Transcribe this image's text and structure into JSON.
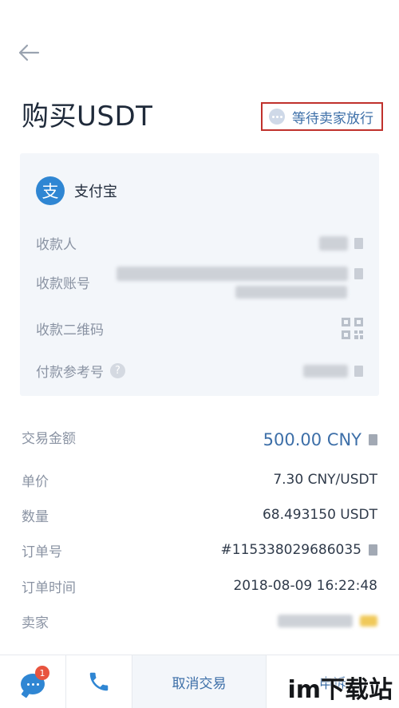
{
  "header": {
    "back_icon": "arrow-left-icon",
    "title": "购买USDT",
    "status": {
      "text": "等待卖家放行",
      "icon": "dots-circle-icon"
    }
  },
  "payment": {
    "method": "支付宝",
    "method_icon": "alipay-icon",
    "method_icon_char": "支",
    "rows": [
      {
        "label": "收款人",
        "icon": "copy-icon"
      },
      {
        "label": "收款账号",
        "icon": "copy-icon"
      },
      {
        "label": "收款二维码",
        "icon": "qr-code-icon"
      },
      {
        "label": "付款参考号",
        "help": "?",
        "icon": "copy-icon"
      }
    ]
  },
  "details": {
    "amount": {
      "label": "交易金额",
      "value": "500.00 CNY"
    },
    "price": {
      "label": "单价",
      "value": "7.30 CNY/USDT"
    },
    "quantity": {
      "label": "数量",
      "value": "68.493150 USDT"
    },
    "order_no": {
      "label": "订单号",
      "value": "#115338029686035"
    },
    "order_time": {
      "label": "订单时间",
      "value": "2018-08-09 16:22:48"
    },
    "seller": {
      "label": "卖家"
    }
  },
  "bottom_bar": {
    "chat_badge": "1",
    "cancel_label": "取消交易",
    "appeal_label": "申诉"
  },
  "watermark": "im下载站",
  "colors": {
    "accent": "#3d6fa8",
    "alipay": "#2f86d3",
    "highlight_border": "#c0312c",
    "badge": "#e8543f",
    "card_bg": "#f3f6fa"
  }
}
